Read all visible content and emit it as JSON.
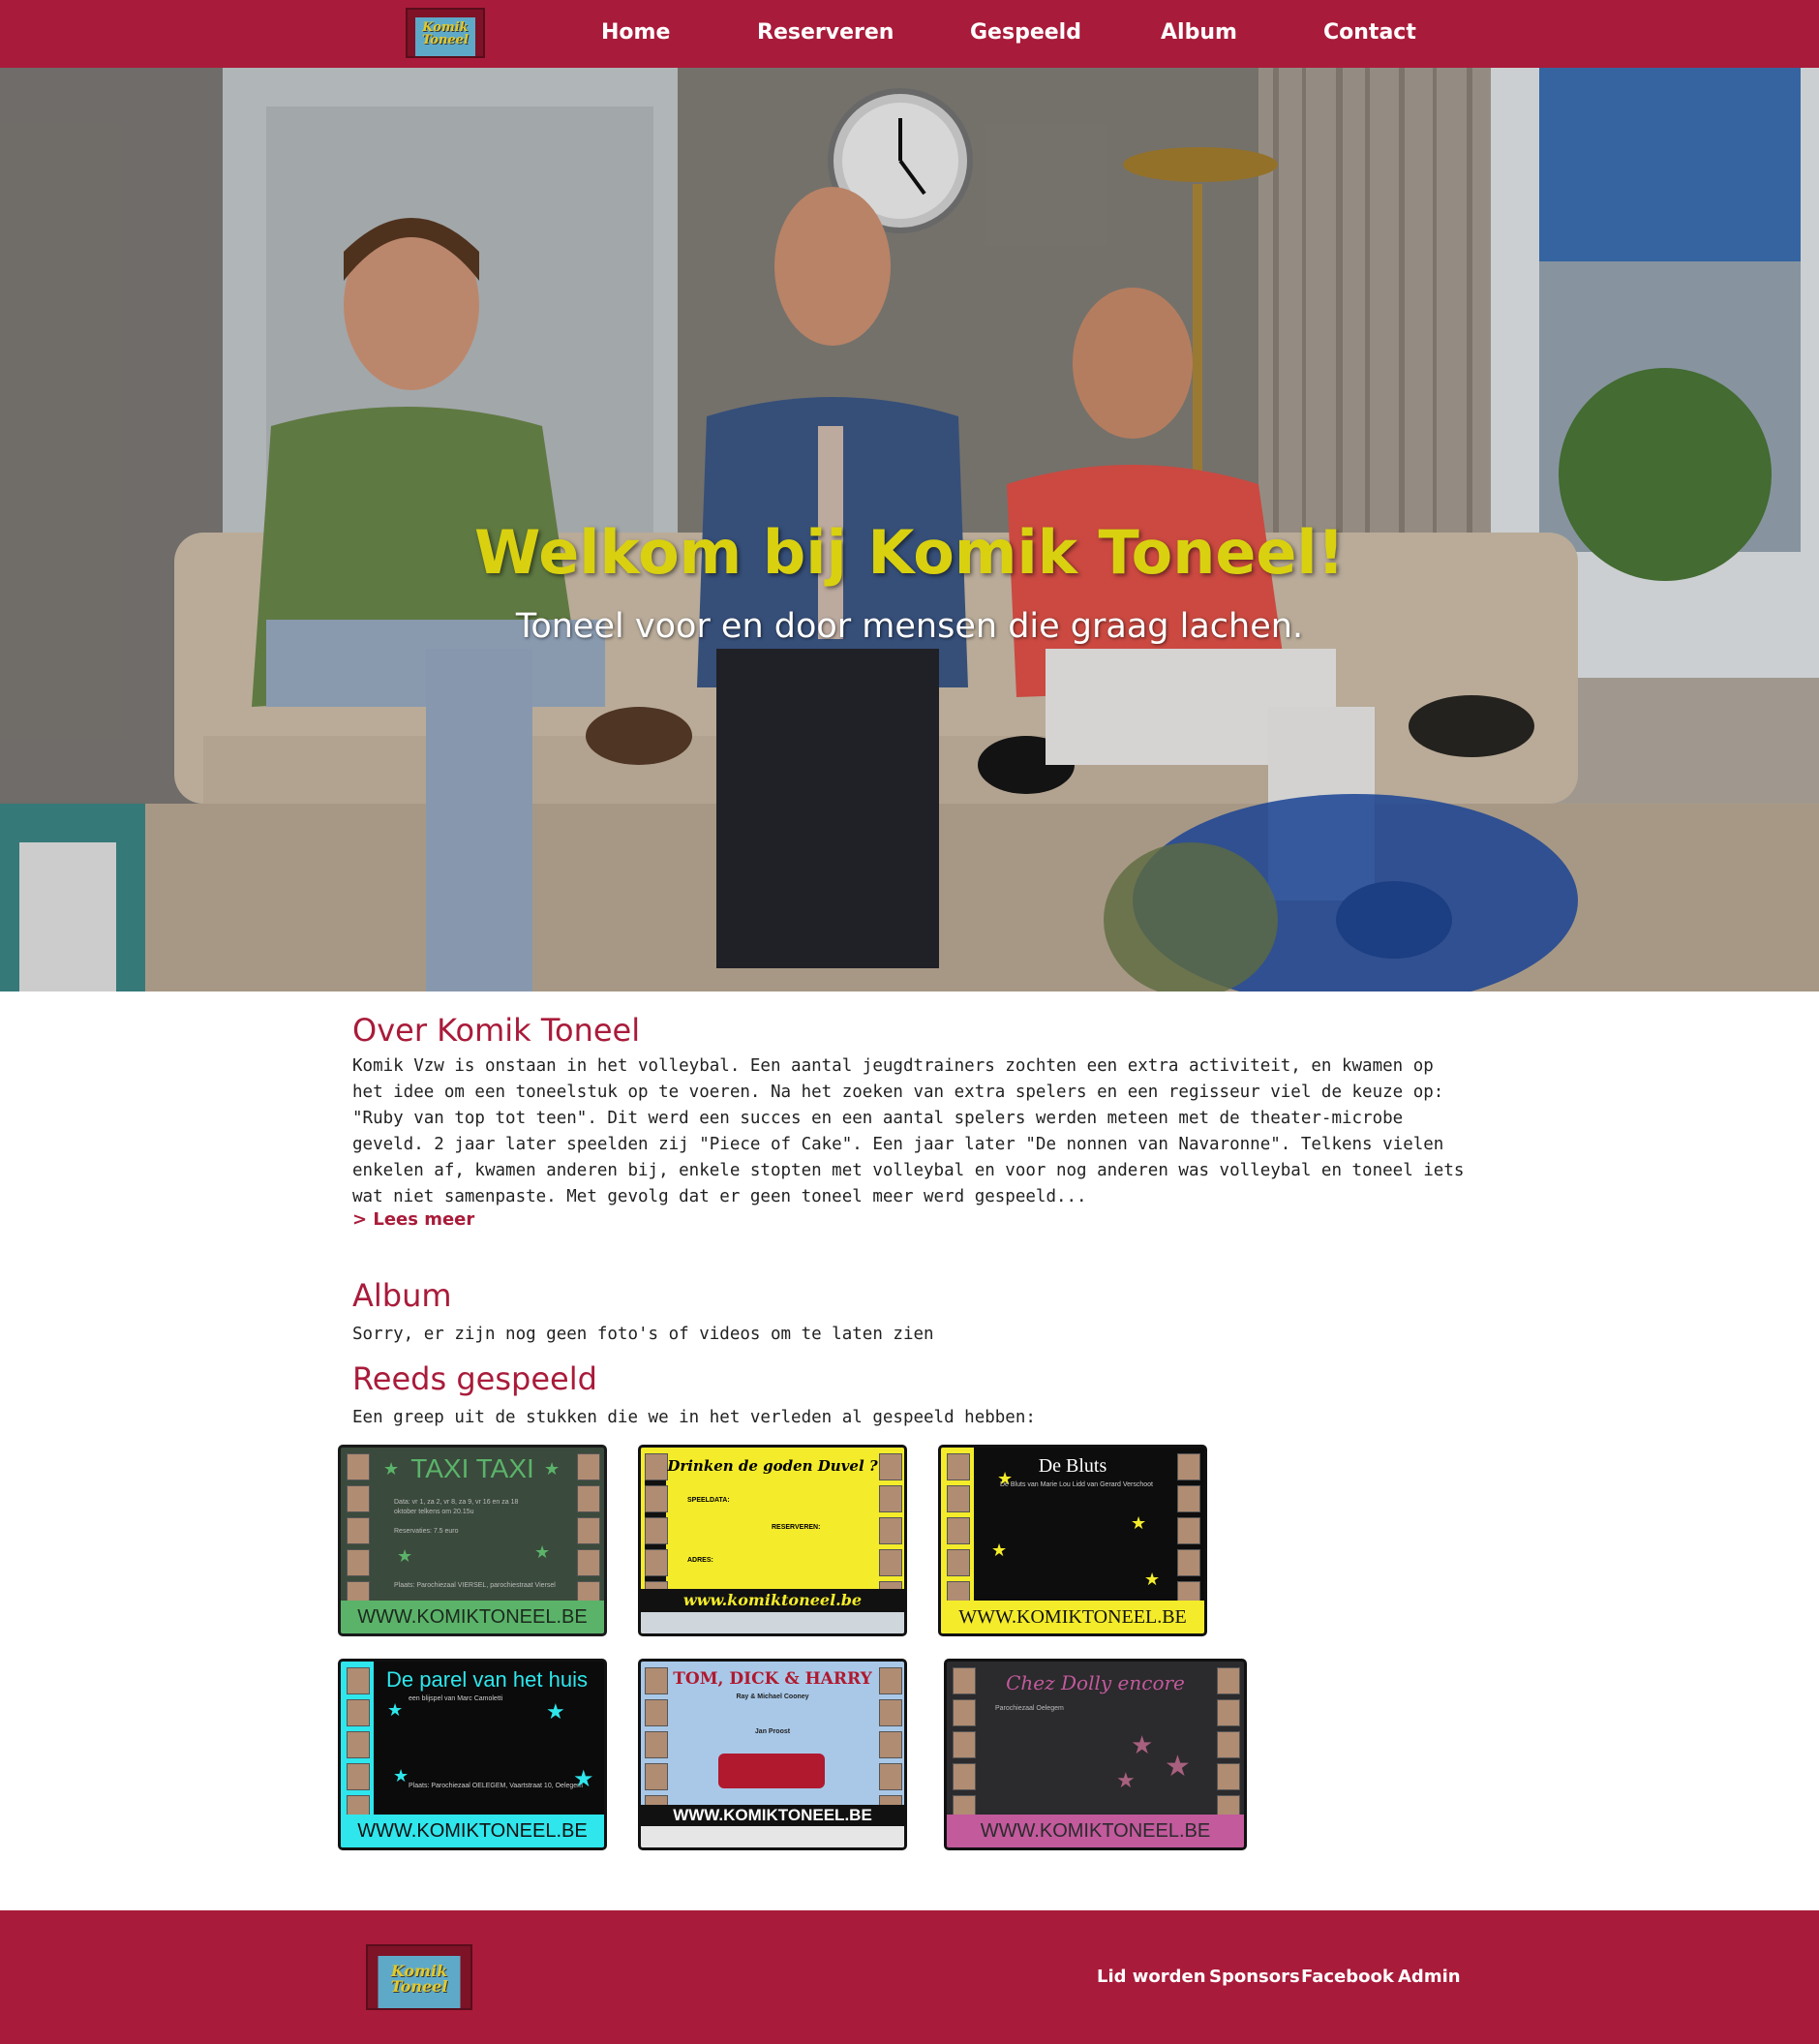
{
  "nav": {
    "logo_text": "Komik Toneel",
    "items": [
      "Home",
      "Reserveren",
      "Gespeeld",
      "Album",
      "Contact"
    ]
  },
  "hero": {
    "title": "Welkom bij Komik Toneel!",
    "subtitle": "Toneel voor en door mensen die graag lachen."
  },
  "about": {
    "title": "Over Komik Toneel",
    "text": "Komik Vzw is onstaan in het volleybal. Een aantal jeugdtrainers zochten een extra activiteit, en kwamen op het idee om een toneelstuk op te voeren. Na het zoeken van extra spelers en een regisseur viel de keuze op: \"Ruby van top tot teen\". Dit werd een succes en een aantal spelers werden meteen met de theater-microbe geveld. 2 jaar later speelden zij \"Piece of Cake\". Een jaar later \"De nonnen van Navaronne\". Telkens vielen enkelen af, kwamen anderen bij, enkele stopten met volleybal en voor nog anderen was volleybal en toneel iets wat niet samenpaste. Met gevolg dat er geen toneel meer werd gespeeld...",
    "read_more": "> Lees meer"
  },
  "album": {
    "title": "Album",
    "text": "Sorry, er zijn nog geen foto's of videos om te laten zien"
  },
  "played": {
    "title": "Reeds gespeeld",
    "intro": "Een greep uit de stukken die we in het verleden al gespeeld hebben:",
    "posters": [
      {
        "title": "TAXI TAXI",
        "footer": "WWW.KOMIKTONEEL.BE",
        "bg": "#3a4a3c",
        "accent": "#5bb36a"
      },
      {
        "title": "Drinken de goden Duvel ?",
        "footer": "www.komiktoneel.be",
        "bg": "#f4ec2a",
        "accent": "#000000"
      },
      {
        "title": "De Bluts",
        "footer": "WWW.KOMIKTONEEL.BE",
        "bg": "#0d0d0d",
        "accent": "#f4ec2a"
      },
      {
        "title": "De parel van het huis",
        "footer": "WWW.KOMIKTONEEL.BE",
        "bg": "#0b0b0b",
        "accent": "#2ee6ec"
      },
      {
        "title": "TOM, DICK & HARRY",
        "footer": "WWW.KOMIKTONEEL.BE",
        "bg": "#a9c8e8",
        "accent": "#b0192e"
      },
      {
        "title": "Chez Dolly encore",
        "footer": "WWW.KOMIKTONEEL.BE",
        "bg": "#2b2a2c",
        "accent": "#c25a9c"
      }
    ],
    "poster_details": {
      "taxi_subtitle": "Data: vr 1, za 2, vr 8, za 9, vr 16 en za 18 oktober telkens om 20.15u",
      "taxi_reserve": "Reservaties: 7.5 euro",
      "taxi_place": "Plaats: Parochiezaal VIERSEL, parochiestraat Viersel",
      "duvel_speeldata": "SPEELDATA:",
      "duvel_reserve": "RESERVEREN:",
      "duvel_adres": "ADRES:",
      "bluts_sub": "De Bluts van Marie Lou Lidd van Gerard Verschoot",
      "parel_sub": "een blijspel van Marc Camoletti",
      "parel_place": "Plaats: Parochiezaal OELEGEM, Vaartstraat 10, Oelegem",
      "tdh_sub": "Ray & Michael Cooney",
      "tdh_regie": "Jan Proost",
      "dolly_sub": "Parochiezaal Oelegem"
    }
  },
  "footer": {
    "logo_text": "Komik Toneel",
    "links": [
      "Lid worden",
      "Sponsors",
      "Facebook",
      "Admin"
    ]
  }
}
